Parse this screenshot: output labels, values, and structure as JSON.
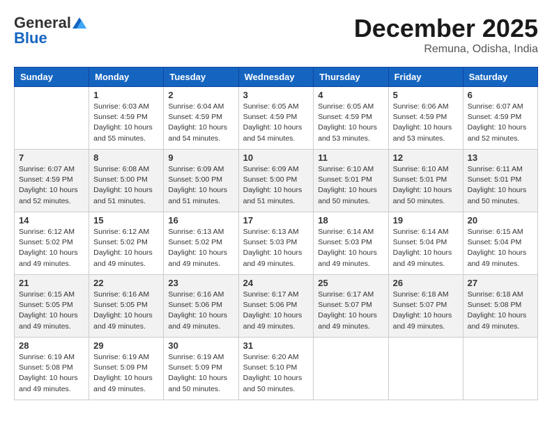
{
  "header": {
    "logo_general": "General",
    "logo_blue": "Blue",
    "month": "December 2025",
    "location": "Remuna, Odisha, India"
  },
  "days_of_week": [
    "Sunday",
    "Monday",
    "Tuesday",
    "Wednesday",
    "Thursday",
    "Friday",
    "Saturday"
  ],
  "weeks": [
    [
      {
        "day": "",
        "sunrise": "",
        "sunset": "",
        "daylight": "",
        "empty": true
      },
      {
        "day": "1",
        "sunrise": "6:03 AM",
        "sunset": "4:59 PM",
        "daylight": "10 hours and 55 minutes."
      },
      {
        "day": "2",
        "sunrise": "6:04 AM",
        "sunset": "4:59 PM",
        "daylight": "10 hours and 54 minutes."
      },
      {
        "day": "3",
        "sunrise": "6:05 AM",
        "sunset": "4:59 PM",
        "daylight": "10 hours and 54 minutes."
      },
      {
        "day": "4",
        "sunrise": "6:05 AM",
        "sunset": "4:59 PM",
        "daylight": "10 hours and 53 minutes."
      },
      {
        "day": "5",
        "sunrise": "6:06 AM",
        "sunset": "4:59 PM",
        "daylight": "10 hours and 53 minutes."
      },
      {
        "day": "6",
        "sunrise": "6:07 AM",
        "sunset": "4:59 PM",
        "daylight": "10 hours and 52 minutes."
      }
    ],
    [
      {
        "day": "7",
        "sunrise": "6:07 AM",
        "sunset": "4:59 PM",
        "daylight": "10 hours and 52 minutes."
      },
      {
        "day": "8",
        "sunrise": "6:08 AM",
        "sunset": "5:00 PM",
        "daylight": "10 hours and 51 minutes."
      },
      {
        "day": "9",
        "sunrise": "6:09 AM",
        "sunset": "5:00 PM",
        "daylight": "10 hours and 51 minutes."
      },
      {
        "day": "10",
        "sunrise": "6:09 AM",
        "sunset": "5:00 PM",
        "daylight": "10 hours and 51 minutes."
      },
      {
        "day": "11",
        "sunrise": "6:10 AM",
        "sunset": "5:01 PM",
        "daylight": "10 hours and 50 minutes."
      },
      {
        "day": "12",
        "sunrise": "6:10 AM",
        "sunset": "5:01 PM",
        "daylight": "10 hours and 50 minutes."
      },
      {
        "day": "13",
        "sunrise": "6:11 AM",
        "sunset": "5:01 PM",
        "daylight": "10 hours and 50 minutes."
      }
    ],
    [
      {
        "day": "14",
        "sunrise": "6:12 AM",
        "sunset": "5:02 PM",
        "daylight": "10 hours and 49 minutes."
      },
      {
        "day": "15",
        "sunrise": "6:12 AM",
        "sunset": "5:02 PM",
        "daylight": "10 hours and 49 minutes."
      },
      {
        "day": "16",
        "sunrise": "6:13 AM",
        "sunset": "5:02 PM",
        "daylight": "10 hours and 49 minutes."
      },
      {
        "day": "17",
        "sunrise": "6:13 AM",
        "sunset": "5:03 PM",
        "daylight": "10 hours and 49 minutes."
      },
      {
        "day": "18",
        "sunrise": "6:14 AM",
        "sunset": "5:03 PM",
        "daylight": "10 hours and 49 minutes."
      },
      {
        "day": "19",
        "sunrise": "6:14 AM",
        "sunset": "5:04 PM",
        "daylight": "10 hours and 49 minutes."
      },
      {
        "day": "20",
        "sunrise": "6:15 AM",
        "sunset": "5:04 PM",
        "daylight": "10 hours and 49 minutes."
      }
    ],
    [
      {
        "day": "21",
        "sunrise": "6:15 AM",
        "sunset": "5:05 PM",
        "daylight": "10 hours and 49 minutes."
      },
      {
        "day": "22",
        "sunrise": "6:16 AM",
        "sunset": "5:05 PM",
        "daylight": "10 hours and 49 minutes."
      },
      {
        "day": "23",
        "sunrise": "6:16 AM",
        "sunset": "5:06 PM",
        "daylight": "10 hours and 49 minutes."
      },
      {
        "day": "24",
        "sunrise": "6:17 AM",
        "sunset": "5:06 PM",
        "daylight": "10 hours and 49 minutes."
      },
      {
        "day": "25",
        "sunrise": "6:17 AM",
        "sunset": "5:07 PM",
        "daylight": "10 hours and 49 minutes."
      },
      {
        "day": "26",
        "sunrise": "6:18 AM",
        "sunset": "5:07 PM",
        "daylight": "10 hours and 49 minutes."
      },
      {
        "day": "27",
        "sunrise": "6:18 AM",
        "sunset": "5:08 PM",
        "daylight": "10 hours and 49 minutes."
      }
    ],
    [
      {
        "day": "28",
        "sunrise": "6:19 AM",
        "sunset": "5:08 PM",
        "daylight": "10 hours and 49 minutes."
      },
      {
        "day": "29",
        "sunrise": "6:19 AM",
        "sunset": "5:09 PM",
        "daylight": "10 hours and 49 minutes."
      },
      {
        "day": "30",
        "sunrise": "6:19 AM",
        "sunset": "5:09 PM",
        "daylight": "10 hours and 50 minutes."
      },
      {
        "day": "31",
        "sunrise": "6:20 AM",
        "sunset": "5:10 PM",
        "daylight": "10 hours and 50 minutes."
      },
      {
        "day": "",
        "sunrise": "",
        "sunset": "",
        "daylight": "",
        "empty": true
      },
      {
        "day": "",
        "sunrise": "",
        "sunset": "",
        "daylight": "",
        "empty": true
      },
      {
        "day": "",
        "sunrise": "",
        "sunset": "",
        "daylight": "",
        "empty": true
      }
    ]
  ],
  "labels": {
    "sunrise_prefix": "Sunrise: ",
    "sunset_prefix": "Sunset: ",
    "daylight_prefix": "Daylight: "
  }
}
